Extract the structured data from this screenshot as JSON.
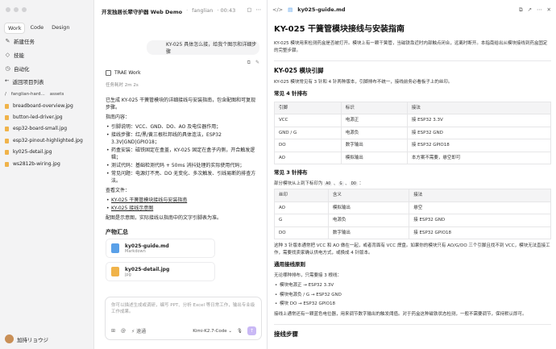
{
  "sidebar": {
    "modes": [
      "Work",
      "Code",
      "Design"
    ],
    "nav": [
      "新建任务",
      "技能",
      "自动化"
    ],
    "back": "返回项目列表",
    "crumb": [
      "/",
      "fanglian-hard...",
      "assets"
    ],
    "files": [
      "breadboard-overview.jpg",
      "button-led-driver.jpg",
      "esp32-board-small.jpg",
      "esp32-pinout-highlighted.jpg",
      "ky025-detail.jpg",
      "ws2812b-wiring.jpg"
    ],
    "user": "加持リョウジ"
  },
  "chat": {
    "title": "开发独居长辈守护器 Web Demo",
    "title_sep": "·",
    "project": "fanglian",
    "time_label": "· 00:43",
    "user_msg": "KY-025 具体怎么接，给我个图示和详细步骤",
    "agent": "TRAE Work",
    "elapsed": "任务耗时 2m 2s",
    "intro": "已生成 KY-025 干簧管模块的详细接线与安装指南，包含配图和可复现步骤。",
    "content_label": "指南内容：",
    "items": [
      "引脚说明：VCC、GND、DO、AO 及电位器作用；",
      "接线步骤：红/黑/黄三根杜邦线的具体连法，ESP32 3.3V|GND|GPIO18；",
      "药盒安装：磁铁固定在盒盖，KY-025 固定在盒子内侧，开合触发逻辑；",
      "测试代码：基础检测代码 + 50ms 消抖处理的实际使用代码；",
      "常见问题：电源灯不亮、DO 无变化、多次触发、引线易断的排查方法。"
    ],
    "files_label": "查看文件：",
    "links": [
      "KY-025 干簧管模块接线与安装指南",
      "KY-025 接线示意图"
    ],
    "note": "配图是示意图，实际接线以指南中的文字引脚表为准。",
    "summary": "产物汇总",
    "cards": [
      {
        "title": "ky025-guide.md",
        "sub": "Markdown"
      },
      {
        "title": "ky025-detail.jpg",
        "sub": "jpg"
      }
    ],
    "input_placeholder": "你可以描述生成或调研，编写 PPT、分析 Excel 等日常工作，输出专业级工作成果。",
    "input_tool": "速通",
    "model": "Kimi-K2.7-Code"
  },
  "doc": {
    "tab": "ky025-guide.md",
    "title": "KY-025 干簧管模块接线与安装指南",
    "intro": "KY-025 模块用来检测药盒是否被打开。模块上有一颗干簧管，当磁铁靠近时内部触点闭合，远离时断开。本指南给出从模块接线到药盒固定的完整步骤。",
    "h_pins": "KY-025 模块引脚",
    "pins_desc": "KY-025 模块常见有 3 针和 4 针两种版本，引脚排布不统一，接线前务必看板子上的丝印。",
    "h_4pin": "常见 4 针排布",
    "t1_head": [
      "引脚",
      "标识",
      "接法"
    ],
    "t1_rows": [
      [
        "VCC",
        "电源正",
        "接 ESP32 3.3V"
      ],
      [
        "GND / G",
        "电源负",
        "接 ESP32 GND"
      ],
      [
        "DO",
        "数字输出",
        "接 ESP32 GPIO18"
      ],
      [
        "AO",
        "模拟输出",
        "本方案不需要，悬空即可"
      ]
    ],
    "h_3pin": "常见 3 针排布",
    "three_desc": "部分模块从上到下标印为",
    "codes": [
      "AO",
      "G",
      "DO"
    ],
    "t2_head": [
      "丝印",
      "含义",
      "接法"
    ],
    "t2_rows": [
      [
        "AO",
        "模拟输出",
        "悬空"
      ],
      [
        "G",
        "电源负",
        "接 ESP32 GND"
      ],
      [
        "DO",
        "数字输出",
        "接 ESP32 GPIO18"
      ]
    ],
    "note3": "这种 3 针版本通常把 VCC 和 AO 做在一起，或者背面有 VCC 焊盘。如果你的模块只有 AO/G/DO 三个引脚且找不到 VCC，模块无法直接工作，需要找卖家确认供电方式，或换成 4 针版本。",
    "h_rule": "通用接线原则",
    "rule_desc": "无论哪种排布，只需要接 3 根线：",
    "rules": [
      "模块电源正 → ESP32 3.3V",
      "模块电源负 / G → ESP32 GND",
      "模块 DO → ESP32 GPIO18"
    ],
    "rule_note": "接线上通常还有一颗蓝色电位器，用来调节数字输出的触发阈值。对于药盒这种磁铁状态检测，一般不需要调节，保持默认即可。",
    "h_next": "接线步骤"
  },
  "colors": {
    "accent": "#c9b8f5",
    "link": "#222222"
  }
}
